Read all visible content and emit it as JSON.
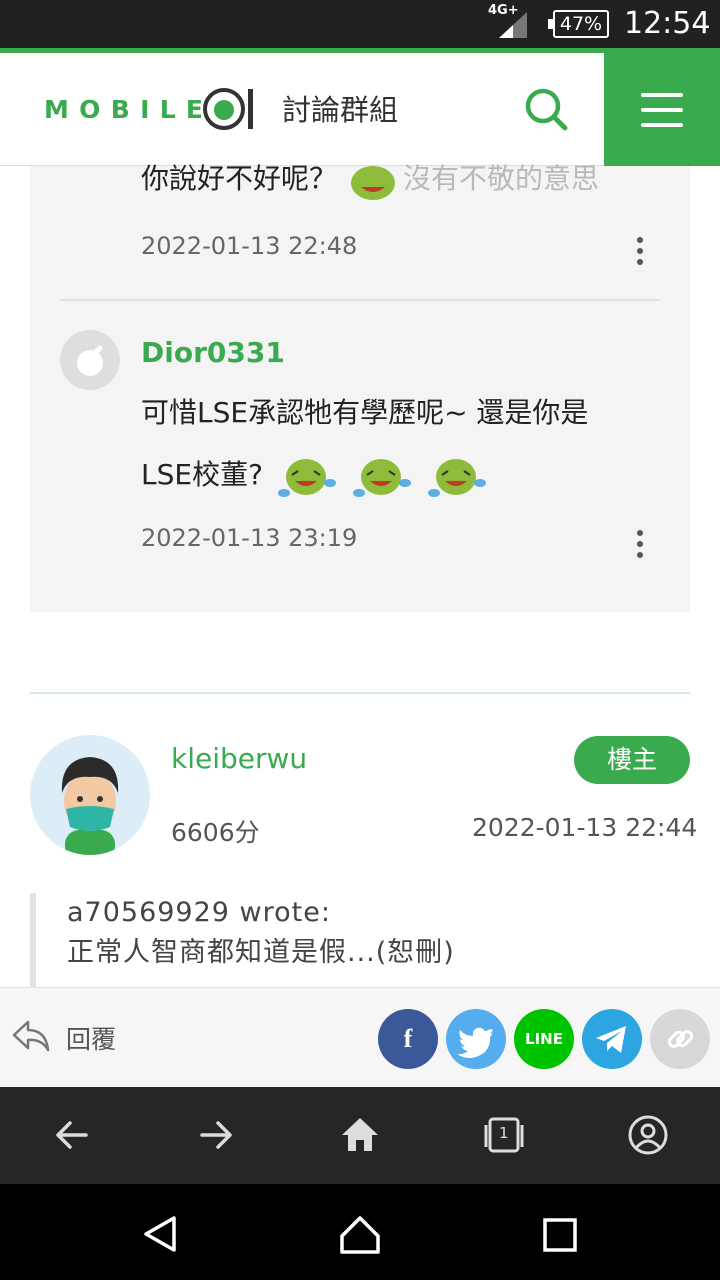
{
  "status_bar": {
    "network": "4G+",
    "battery": "47%",
    "time": "12:54"
  },
  "header": {
    "logo_text": "MOBILE01",
    "section_title": "討論群組"
  },
  "comments": [
    {
      "text": "你說好不好呢？",
      "trailing_text": "沒有不敬的意思",
      "time": "2022-01-13 22:48"
    },
    {
      "user": "Dior0331",
      "text_line1": "可惜LSE承認牠有學歷呢~ 還是你是",
      "text_line2": "LSE校董?",
      "emoji_count": 3,
      "time": "2022-01-13 23:19"
    }
  ],
  "post": {
    "user": "kleiberwu",
    "badge": "樓主",
    "score": "6606分",
    "time": "2022-01-13 22:44",
    "quote_author": "a70569929 wrote:",
    "quote_text": "正常人智商都知道是假...(恕刪)"
  },
  "actions": {
    "reply_label": "回覆",
    "share_buttons": [
      {
        "name": "facebook",
        "label": "f",
        "color": "#3b5998"
      },
      {
        "name": "twitter",
        "label": "",
        "color": "#55acee"
      },
      {
        "name": "line",
        "label": "LINE",
        "color": "#00c300"
      },
      {
        "name": "telegram",
        "label": "",
        "color": "#2ca5e0"
      },
      {
        "name": "copy-link",
        "label": "",
        "color": "#d8d8d8"
      }
    ]
  },
  "browser": {
    "tab_count": "1"
  },
  "colors": {
    "brand_green": "#3aaa4e"
  }
}
